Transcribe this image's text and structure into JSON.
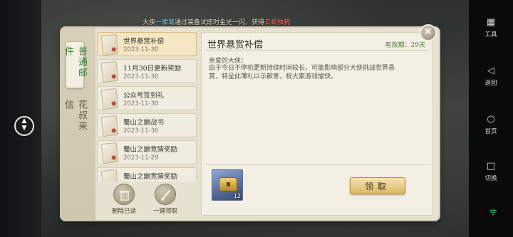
{
  "notice": {
    "prefix": "大侠",
    "player": "一啸葛",
    "middle": "通过装备试炼时金光一闪，获得",
    "item": "云蛟独腕"
  },
  "tabs": [
    {
      "label": "普通邮件",
      "active": true
    },
    {
      "label": "花叔来信",
      "active": false
    }
  ],
  "mails": [
    {
      "title": "世界悬赏补偿",
      "date": "2023-11-30",
      "selected": true
    },
    {
      "title": "11月30日更新奖励",
      "date": "2023-11-30",
      "selected": false
    },
    {
      "title": "公众号签到礼",
      "date": "2023-11-30",
      "selected": false
    },
    {
      "title": "蜀山之巅战书",
      "date": "2023-11-30",
      "selected": false
    },
    {
      "title": "蜀山之巅竞猜奖励",
      "date": "2023-11-29",
      "selected": false
    },
    {
      "title": "蜀山之巅竞猜奖励",
      "date": "",
      "selected": false
    }
  ],
  "actions": {
    "delete_read": "删除已读",
    "claim_all": "一键领取"
  },
  "detail": {
    "title": "世界悬赏补偿",
    "expire": "有效期：29天",
    "greeting": "亲爱的大侠：",
    "body": "由于今日不停机更新持续时间较长，可能影响部分大侠挑战世界悬赏，特呈此薄礼以示歉意，祝大家游戏愉快。",
    "reward_icon": "treasure-chest-icon",
    "reward_count": "12",
    "claim_label": "领取"
  },
  "close_icon": "close-icon",
  "system_bar": [
    {
      "icon": "grid-icon",
      "glyph": "▦",
      "label": "工具"
    },
    {
      "icon": "back-icon",
      "glyph": "◁",
      "label": "返回"
    },
    {
      "icon": "home-icon",
      "glyph": "○",
      "label": "首页"
    },
    {
      "icon": "switch-icon",
      "glyph": "□",
      "label": "切换"
    }
  ],
  "colors": {
    "accent_green": "#3d7a3a",
    "player_blue": "#7fd2ff",
    "item_red": "#ff7a6a",
    "button_gold": "#d9b868"
  }
}
